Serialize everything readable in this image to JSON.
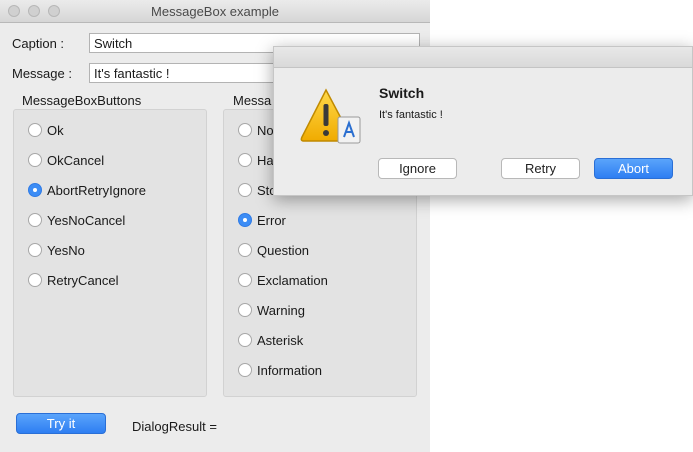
{
  "window": {
    "title": "MessageBox example"
  },
  "form": {
    "caption_label": "Caption :",
    "caption_value": "Switch",
    "message_label": "Message :",
    "message_value": "It's fantastic !"
  },
  "buttons_group": {
    "title": "MessageBoxButtons",
    "options": [
      {
        "label": "Ok",
        "selected": false
      },
      {
        "label": "OkCancel",
        "selected": false
      },
      {
        "label": "AbortRetryIgnore",
        "selected": true
      },
      {
        "label": "YesNoCancel",
        "selected": false
      },
      {
        "label": "YesNo",
        "selected": false
      },
      {
        "label": "RetryCancel",
        "selected": false
      }
    ]
  },
  "icon_group": {
    "title_visible": "Messa",
    "options": [
      {
        "label": "No",
        "selected": false
      },
      {
        "label": "Ha",
        "selected": false
      },
      {
        "label": "Sto",
        "selected": false
      },
      {
        "label": "Error",
        "selected": true
      },
      {
        "label": "Question",
        "selected": false
      },
      {
        "label": "Exclamation",
        "selected": false
      },
      {
        "label": "Warning",
        "selected": false
      },
      {
        "label": "Asterisk",
        "selected": false
      },
      {
        "label": "Information",
        "selected": false
      }
    ]
  },
  "footer": {
    "try_label": "Try it",
    "result_label": "DialogResult ="
  },
  "dialog": {
    "title": "Switch",
    "message": "It's fantastic !",
    "icon": "warning-icon",
    "buttons": {
      "ignore": "Ignore",
      "retry": "Retry",
      "abort": "Abort"
    }
  },
  "colors": {
    "accent": "#3d8df5",
    "window_bg": "#ececec",
    "group_bg": "#e3e3e3"
  }
}
